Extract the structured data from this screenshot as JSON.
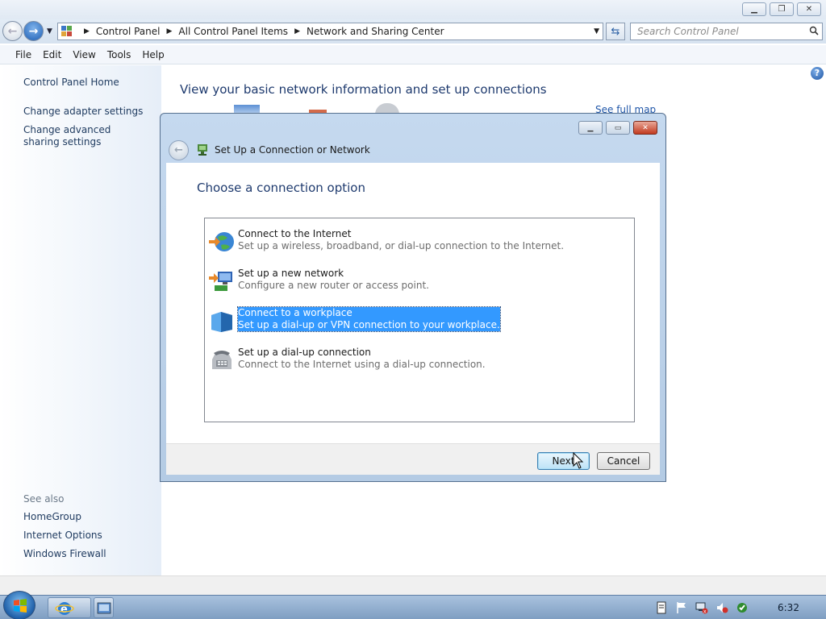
{
  "explorer": {
    "breadcrumb": [
      "Control Panel",
      "All Control Panel Items",
      "Network and Sharing Center"
    ],
    "search_placeholder": "Search Control Panel",
    "menu": [
      "File",
      "Edit",
      "View",
      "Tools",
      "Help"
    ]
  },
  "left_pane": {
    "home": "Control Panel Home",
    "links": [
      "Change adapter settings",
      "Change advanced sharing settings"
    ],
    "see_also_label": "See also",
    "see_also": [
      "HomeGroup",
      "Internet Options",
      "Windows Firewall"
    ]
  },
  "main": {
    "title": "View your basic network information and set up connections",
    "see_full_map": "See full map"
  },
  "dialog": {
    "title": "Set Up a Connection or Network",
    "heading": "Choose a connection option",
    "options": [
      {
        "title": "Connect to the Internet",
        "desc": "Set up a wireless, broadband, or dial-up connection to the Internet.",
        "icon": "globe-internet-icon"
      },
      {
        "title": "Set up a new network",
        "desc": "Configure a new router or access point.",
        "icon": "new-network-icon"
      },
      {
        "title": "Connect to a workplace",
        "desc": "Set up a dial-up or VPN connection to your workplace.",
        "icon": "workplace-icon"
      },
      {
        "title": "Set up a dial-up connection",
        "desc": "Connect to the Internet using a dial-up connection.",
        "icon": "phone-icon"
      }
    ],
    "selected_option": "Connect to a workplace",
    "next_label": "Next",
    "cancel_label": "Cancel"
  },
  "taskbar": {
    "clock": "6:32"
  },
  "colors": {
    "selection": "#3399ff",
    "link": "#1e3a5f",
    "heading": "#1e3a6e"
  }
}
